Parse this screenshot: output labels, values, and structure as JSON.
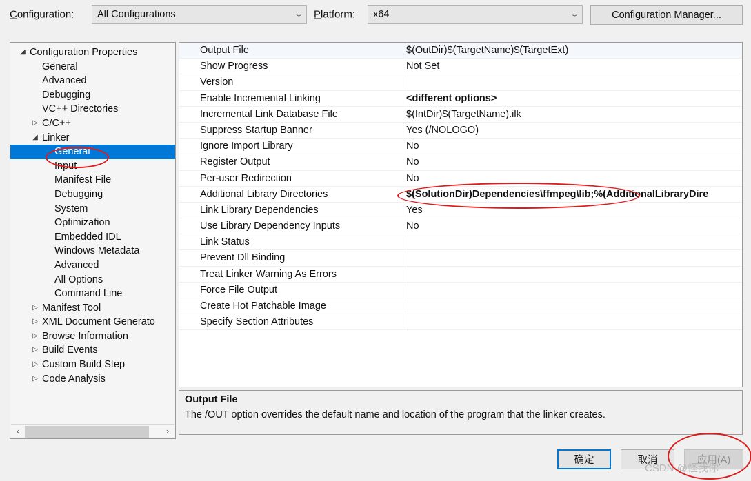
{
  "toolbar": {
    "configuration_label": "Configuration:",
    "configuration_value": "All Configurations",
    "platform_label": "Platform:",
    "platform_value": "x64",
    "config_manager_label": "Configuration Manager...",
    "chevron_glyph": "⌄"
  },
  "tree": {
    "collapsed_glyph": "▷",
    "expanded_glyph": "◢",
    "selected": "Linker > General",
    "items": [
      {
        "label": "Configuration Properties",
        "depth": 0,
        "state": "expanded"
      },
      {
        "label": "General",
        "depth": 1,
        "state": "leaf"
      },
      {
        "label": "Advanced",
        "depth": 1,
        "state": "leaf"
      },
      {
        "label": "Debugging",
        "depth": 1,
        "state": "leaf"
      },
      {
        "label": "VC++ Directories",
        "depth": 1,
        "state": "leaf"
      },
      {
        "label": "C/C++",
        "depth": 1,
        "state": "collapsed"
      },
      {
        "label": "Linker",
        "depth": 1,
        "state": "expanded"
      },
      {
        "label": "General",
        "depth": 2,
        "state": "leaf",
        "selected": true
      },
      {
        "label": "Input",
        "depth": 2,
        "state": "leaf"
      },
      {
        "label": "Manifest File",
        "depth": 2,
        "state": "leaf"
      },
      {
        "label": "Debugging",
        "depth": 2,
        "state": "leaf"
      },
      {
        "label": "System",
        "depth": 2,
        "state": "leaf"
      },
      {
        "label": "Optimization",
        "depth": 2,
        "state": "leaf"
      },
      {
        "label": "Embedded IDL",
        "depth": 2,
        "state": "leaf"
      },
      {
        "label": "Windows Metadata",
        "depth": 2,
        "state": "leaf"
      },
      {
        "label": "Advanced",
        "depth": 2,
        "state": "leaf"
      },
      {
        "label": "All Options",
        "depth": 2,
        "state": "leaf"
      },
      {
        "label": "Command Line",
        "depth": 2,
        "state": "leaf"
      },
      {
        "label": "Manifest Tool",
        "depth": 1,
        "state": "collapsed"
      },
      {
        "label": "XML Document Generato",
        "depth": 1,
        "state": "collapsed"
      },
      {
        "label": "Browse Information",
        "depth": 1,
        "state": "collapsed"
      },
      {
        "label": "Build Events",
        "depth": 1,
        "state": "collapsed"
      },
      {
        "label": "Custom Build Step",
        "depth": 1,
        "state": "collapsed"
      },
      {
        "label": "Code Analysis",
        "depth": 1,
        "state": "collapsed"
      }
    ],
    "scrollbar": {
      "left_glyph": "‹",
      "right_glyph": "›"
    }
  },
  "grid": {
    "rows": [
      {
        "name": "Output File",
        "value": "$(OutDir)$(TargetName)$(TargetExt)",
        "bold": false,
        "selected": true
      },
      {
        "name": "Show Progress",
        "value": "Not Set",
        "bold": false
      },
      {
        "name": "Version",
        "value": "",
        "bold": false
      },
      {
        "name": "Enable Incremental Linking",
        "value": "<different options>",
        "bold": true
      },
      {
        "name": "Incremental Link Database File",
        "value": "$(IntDir)$(TargetName).ilk",
        "bold": false
      },
      {
        "name": "Suppress Startup Banner",
        "value": "Yes (/NOLOGO)",
        "bold": false
      },
      {
        "name": "Ignore Import Library",
        "value": "No",
        "bold": false
      },
      {
        "name": "Register Output",
        "value": "No",
        "bold": false
      },
      {
        "name": "Per-user Redirection",
        "value": "No",
        "bold": false
      },
      {
        "name": "Additional Library Directories",
        "value": "$(SolutionDir)Dependencies\\ffmpeg\\lib;%(AdditionalLibraryDire",
        "bold": true
      },
      {
        "name": "Link Library Dependencies",
        "value": "Yes",
        "bold": false
      },
      {
        "name": "Use Library Dependency Inputs",
        "value": "No",
        "bold": false
      },
      {
        "name": "Link Status",
        "value": "",
        "bold": false
      },
      {
        "name": "Prevent Dll Binding",
        "value": "",
        "bold": false
      },
      {
        "name": "Treat Linker Warning As Errors",
        "value": "",
        "bold": false
      },
      {
        "name": "Force File Output",
        "value": "",
        "bold": false
      },
      {
        "name": "Create Hot Patchable Image",
        "value": "",
        "bold": false
      },
      {
        "name": "Specify Section Attributes",
        "value": "",
        "bold": false
      }
    ]
  },
  "description": {
    "title": "Output File",
    "body": "The /OUT option overrides the default name and location of the program that the linker creates."
  },
  "footer": {
    "ok_label": "确定",
    "cancel_label": "取消",
    "apply_label": "应用(A)",
    "watermark": "CSDN @怪我你"
  },
  "annotations": {
    "accent_color": "#e01b1b",
    "highlight_color": "#0078d7"
  }
}
